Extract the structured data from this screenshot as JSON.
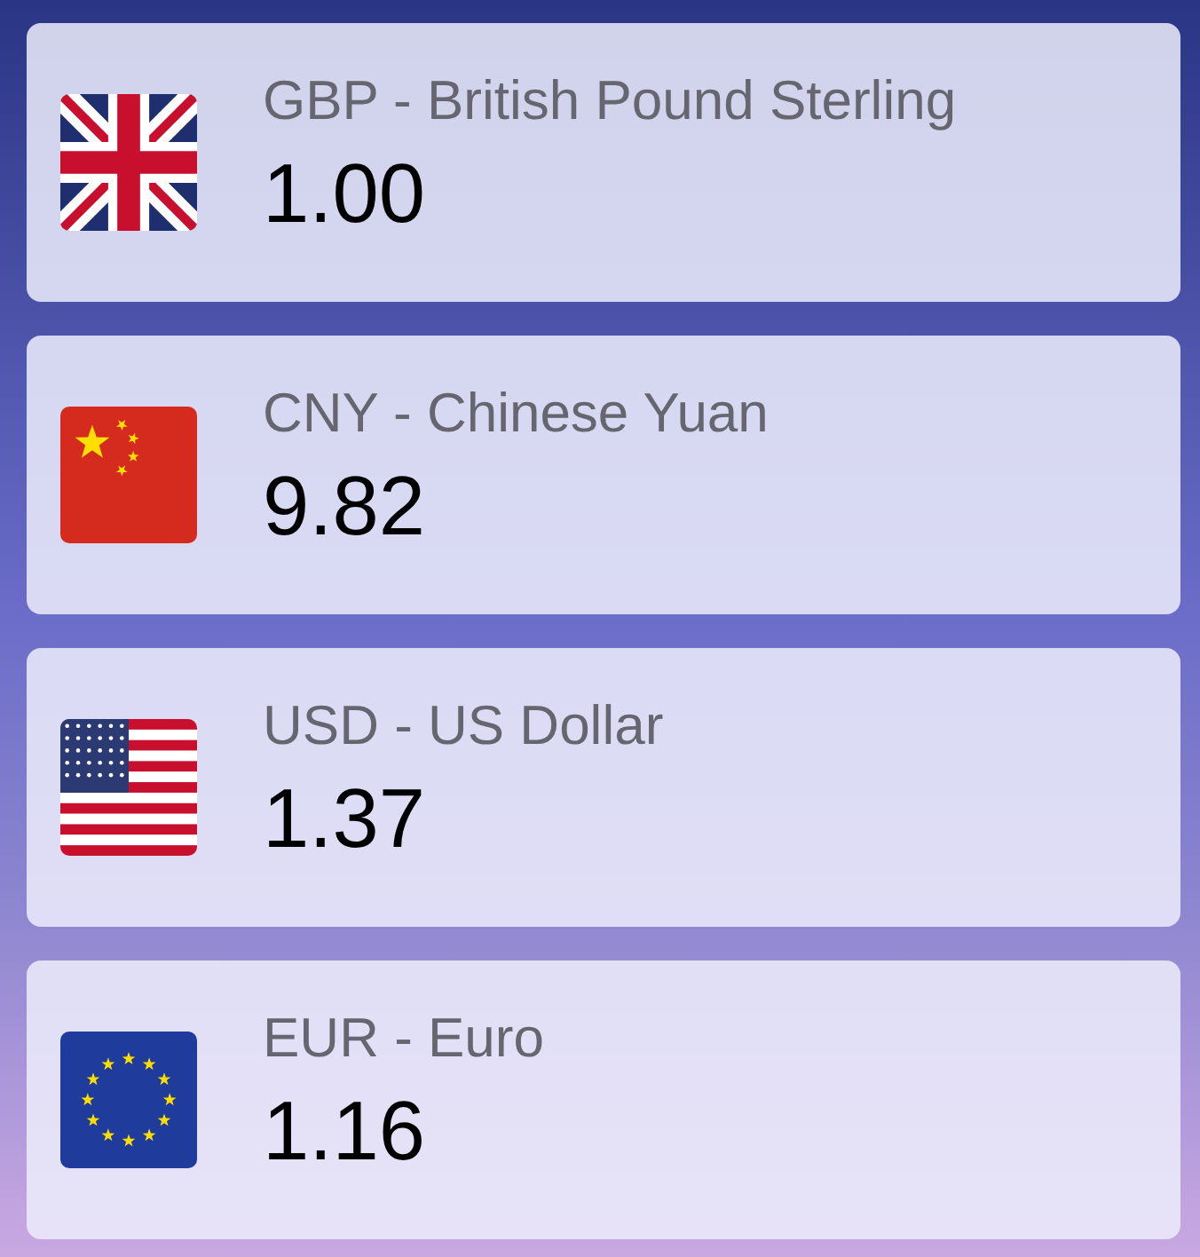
{
  "currencies": [
    {
      "kind": "uk",
      "label": "GBP - British Pound Sterling",
      "rate": "1.00"
    },
    {
      "kind": "china",
      "label": "CNY - Chinese Yuan",
      "rate": "9.82"
    },
    {
      "kind": "usa",
      "label": "USD - US Dollar",
      "rate": "1.37"
    },
    {
      "kind": "eu",
      "label": "EUR - Euro",
      "rate": "1.16"
    }
  ]
}
